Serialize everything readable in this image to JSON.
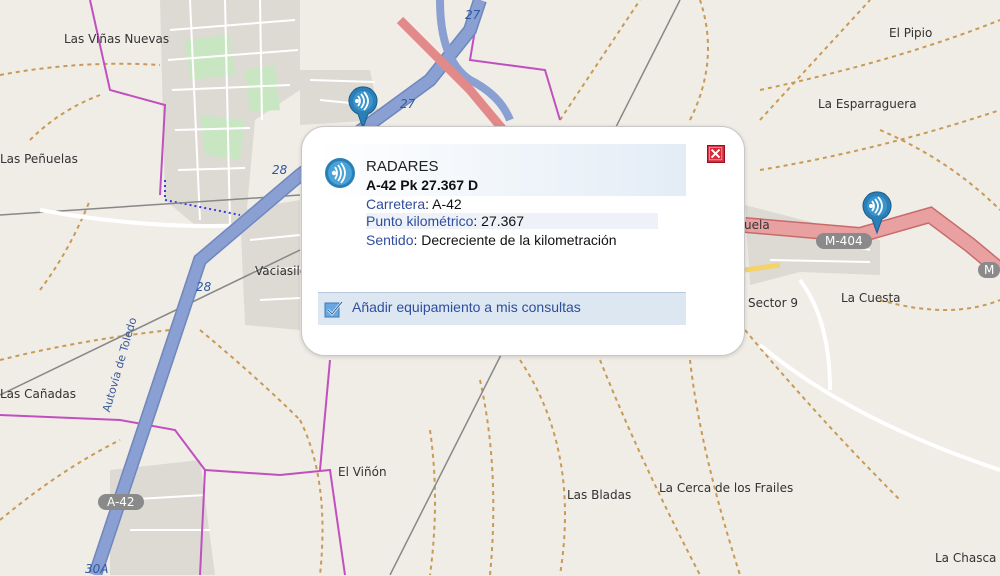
{
  "places": {
    "las_vinas_nuevas": "Las Viñas Nuevas",
    "el_pipio": "El Pipio",
    "la_esparraguera": "La Esparraguera",
    "las_penuelas": "Las Peñuelas",
    "vaciasilo": "Vaciasilo",
    "suela": "uela",
    "sector_9": "Sector 9",
    "la_cuesta": "La Cuesta",
    "las_canadas": "Las Cañadas",
    "el_vinon": "El Viñón",
    "las_bladas": "Las Bladas",
    "la_cerca": "La Cerca de los Frailes",
    "la_chasca": "La Chasca"
  },
  "roads": {
    "shield_m404": "M-404",
    "shield_m_cut": "M",
    "shield_a42": "A-42",
    "num_27a": "27",
    "num_27b": "27",
    "num_28a": "28",
    "num_28b": "28",
    "num_30a": "30A",
    "autovia": "Autovía de Toledo"
  },
  "popup": {
    "category": "RADARES",
    "heading": "A-42 Pk 27.367 D",
    "road_label": "Carretera",
    "road_value": ": A-42",
    "pk_label": "Punto kilométrico",
    "pk_value": ": 27.367",
    "dir_label": "Sentido",
    "dir_value": ": Decreciente de la kilometración",
    "add_label": "Añadir equipamiento a mis consultas"
  },
  "icons": {
    "radar": "radar-icon",
    "close": "close-icon",
    "check": "checkbox-icon",
    "pin": "map-pin-icon"
  },
  "colors": {
    "background": "#f0ece6",
    "highway": "#8aa0d2",
    "primary_road": "#e28a8a",
    "boundary": "#c050c0",
    "track": "#c89a55",
    "popup_accent": "#2e4e9c",
    "close_red": "#d42a3a",
    "pin_blue": "#2a7fb8"
  }
}
